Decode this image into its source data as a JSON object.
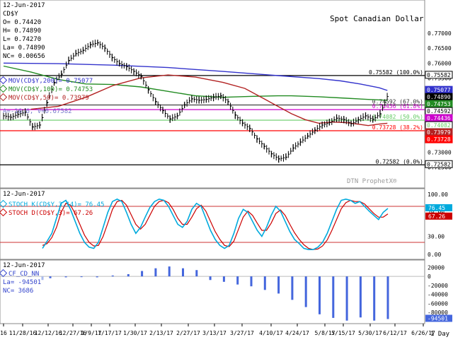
{
  "chart_data": [
    {
      "type": "ohlc",
      "panel": "price",
      "title": "Spot Canadian Dollar",
      "date": "12-Jun-2017",
      "symbol": "CD$Y",
      "ohlc_readout": [
        {
          "label": "O",
          "value": "0.74420"
        },
        {
          "label": "H",
          "value": "0.74890"
        },
        {
          "label": "L",
          "value": "0.74270"
        },
        {
          "label": "La",
          "value": "0.74890"
        },
        {
          "label": "NC",
          "value": "0.00656"
        }
      ],
      "legend": [
        {
          "text": "MOV(CD$Y,200)= 0.75077",
          "color": "#3333cc"
        },
        {
          "text": "MOV(CD$Y,100)= 0.74753",
          "color": "#228b22"
        },
        {
          "text": "MOV(CD$Y,50)= 0.73979",
          "color": "#b22222"
        }
      ],
      "extra_readout": "A=-16.6, V=0.67582",
      "ylim": [
        0.719,
        0.78
      ],
      "y_ticks": [
        "0.77000",
        "0.76500",
        "0.76000",
        "0.75500",
        "0.75000",
        "0.74500",
        "0.74000",
        "0.73500",
        "0.73000",
        "0.72500"
      ],
      "tick_values": [
        0.77,
        0.765,
        0.76,
        0.755,
        0.75,
        0.745,
        0.74,
        0.735,
        0.73,
        0.725
      ],
      "fib_levels": [
        {
          "value": 0.75582,
          "label": "0.75582 (100.0%)",
          "color": "#000000"
        },
        {
          "value": 0.74592,
          "label": "0.74592 (67.0%)",
          "color": "#333333"
        },
        {
          "value": 0.74436,
          "label": "0.74436 (61.8%)",
          "color": "#cc00cc"
        },
        {
          "value": 0.74082,
          "label": "0.74082 (50.0%)",
          "color": "#66cc66"
        },
        {
          "value": 0.73728,
          "label": "0.73728 (38.2%)",
          "color": "#ff0000"
        },
        {
          "value": 0.72582,
          "label": "0.72582 (0.0%)",
          "color": "#000000"
        }
      ],
      "right_badges": [
        {
          "value": 0.75582,
          "text": "0.75582",
          "bg": "#ffffff",
          "fg": "#000000"
        },
        {
          "value": 0.75077,
          "text": "0.75077",
          "bg": "#3333cc",
          "fg": "#ffffff"
        },
        {
          "value": 0.7489,
          "text": "0.74890",
          "bg": "#000000",
          "fg": "#ffffff"
        },
        {
          "value": 0.74753,
          "text": "0.74753",
          "bg": "#228b22",
          "fg": "#ffffff"
        },
        {
          "value": 0.74592,
          "text": "0.74592",
          "bg": "#ffffff",
          "fg": "#000000"
        },
        {
          "value": 0.74436,
          "text": "0.74436",
          "bg": "#cc00cc",
          "fg": "#ffffff"
        },
        {
          "value": 0.74082,
          "text": "0.74082",
          "bg": "#ffffff",
          "fg": "#66cc66"
        },
        {
          "value": 0.73979,
          "text": "0.73979",
          "bg": "#b22222",
          "fg": "#ffffff"
        },
        {
          "value": 0.73728,
          "text": "0.73728",
          "bg": "#ff0000",
          "fg": "#ffffff"
        },
        {
          "value": 0.72582,
          "text": "0.72582",
          "bg": "#ffffff",
          "fg": "#000000"
        }
      ],
      "series": [
        {
          "name": "MOV(CD$Y,200)",
          "color": "#3333cc",
          "points": [
            [
              0,
              0.76
            ],
            [
              20,
              0.7598
            ],
            [
              40,
              0.7593
            ],
            [
              60,
              0.7585
            ],
            [
              80,
              0.7572
            ],
            [
              100,
              0.7558
            ],
            [
              115,
              0.7548
            ],
            [
              123,
              0.754
            ],
            [
              130,
              0.753
            ],
            [
              137,
              0.7517
            ],
            [
              140,
              0.7508
            ]
          ]
        },
        {
          "name": "MOV(CD$Y,100)",
          "color": "#228b22",
          "points": [
            [
              0,
              0.759
            ],
            [
              10,
              0.757
            ],
            [
              20,
              0.7545
            ],
            [
              30,
              0.753
            ],
            [
              40,
              0.7528
            ],
            [
              50,
              0.752
            ],
            [
              60,
              0.7505
            ],
            [
              70,
              0.749
            ],
            [
              80,
              0.7485
            ],
            [
              90,
              0.7488
            ],
            [
              100,
              0.749
            ],
            [
              105,
              0.749
            ],
            [
              115,
              0.7487
            ],
            [
              125,
              0.7482
            ],
            [
              133,
              0.7478
            ],
            [
              140,
              0.7475
            ]
          ]
        },
        {
          "name": "MOV(CD$Y,50)",
          "color": "#b22222",
          "points": [
            [
              10,
              0.7445
            ],
            [
              20,
              0.7455
            ],
            [
              30,
              0.7485
            ],
            [
              40,
              0.7525
            ],
            [
              50,
              0.755
            ],
            [
              60,
              0.756
            ],
            [
              70,
              0.7553
            ],
            [
              80,
              0.7535
            ],
            [
              88,
              0.7515
            ],
            [
              95,
              0.748
            ],
            [
              100,
              0.7455
            ],
            [
              105,
              0.743
            ],
            [
              110,
              0.741
            ],
            [
              115,
              0.7398
            ],
            [
              120,
              0.7402
            ],
            [
              125,
              0.74
            ],
            [
              130,
              0.7394
            ],
            [
              133,
              0.739
            ],
            [
              137,
              0.7395
            ],
            [
              140,
              0.7398
            ]
          ]
        },
        {
          "name": "closes",
          "points": [
            [
              0,
              0.7423
            ],
            [
              4,
              0.7418
            ],
            [
              8,
              0.7428
            ],
            [
              12,
              0.7435
            ],
            [
              16,
              0.7385
            ],
            [
              20,
              0.7392
            ],
            [
              24,
              0.7468
            ],
            [
              28,
              0.7535
            ],
            [
              32,
              0.7563
            ],
            [
              36,
              0.7609
            ],
            [
              40,
              0.7632
            ],
            [
              44,
              0.7643
            ],
            [
              48,
              0.7662
            ],
            [
              52,
              0.7668
            ],
            [
              56,
              0.765
            ],
            [
              60,
              0.7618
            ],
            [
              64,
              0.7598
            ],
            [
              68,
              0.7588
            ],
            [
              72,
              0.7572
            ],
            [
              76,
              0.7555
            ],
            [
              80,
              0.751
            ],
            [
              84,
              0.747
            ],
            [
              88,
              0.744
            ],
            [
              92,
              0.7412
            ],
            [
              96,
              0.7423
            ],
            [
              100,
              0.746
            ],
            [
              104,
              0.748
            ],
            [
              108,
              0.7475
            ],
            [
              112,
              0.7478
            ],
            [
              116,
              0.7485
            ],
            [
              120,
              0.749
            ],
            [
              124,
              0.747
            ],
            [
              128,
              0.7425
            ],
            [
              132,
              0.7398
            ],
            [
              136,
              0.738
            ],
            [
              140,
              0.7345
            ],
            [
              144,
              0.732
            ],
            [
              148,
              0.7295
            ],
            [
              152,
              0.7278
            ],
            [
              156,
              0.7284
            ],
            [
              160,
              0.7315
            ],
            [
              164,
              0.7335
            ],
            [
              168,
              0.7355
            ],
            [
              172,
              0.7375
            ],
            [
              176,
              0.7392
            ],
            [
              180,
              0.74
            ],
            [
              184,
              0.7415
            ],
            [
              188,
              0.741
            ],
            [
              192,
              0.7396
            ],
            [
              196,
              0.741
            ],
            [
              200,
              0.7423
            ],
            [
              204,
              0.741
            ],
            [
              208,
              0.743
            ],
            [
              212,
              0.7489
            ]
          ]
        }
      ],
      "watermark": "DTN ProphetX®"
    },
    {
      "type": "line",
      "panel": "stochastic",
      "date": "12-Jun-2017",
      "legend": [
        {
          "text": "STOCH K(CD$Y,3,14)= 76.45",
          "color": "#00aadd"
        },
        {
          "text": "STOCH D(CD$Y,3)= 67.26",
          "color": "#cc0000"
        }
      ],
      "ylim": [
        0,
        100
      ],
      "y_ticks": [
        "100.00",
        "70.00",
        "30.00",
        "0.00"
      ],
      "tick_values": [
        100,
        70,
        30,
        0
      ],
      "levels": [
        80,
        20
      ],
      "right_badges": [
        {
          "value": 76.45,
          "text": "76.45",
          "bg": "#00aadd",
          "fg": "#ffffff"
        },
        {
          "value": 67.26,
          "text": "67.26",
          "bg": "#cc0000",
          "fg": "#ffffff"
        }
      ],
      "k_values": [
        10,
        22,
        35,
        60,
        85,
        90,
        75,
        55,
        35,
        20,
        12,
        10,
        20,
        45,
        70,
        88,
        92,
        88,
        70,
        50,
        35,
        45,
        62,
        78,
        88,
        92,
        90,
        80,
        65,
        50,
        45,
        55,
        75,
        85,
        80,
        60,
        40,
        25,
        15,
        10,
        15,
        35,
        60,
        75,
        70,
        55,
        40,
        30,
        45,
        65,
        80,
        72,
        55,
        38,
        25,
        18,
        10,
        8,
        8,
        12,
        20,
        35,
        55,
        75,
        90,
        92,
        90,
        85,
        88,
        80,
        72,
        65,
        58,
        70,
        76.45
      ],
      "d_values": [
        15,
        18,
        28,
        45,
        70,
        85,
        82,
        68,
        50,
        32,
        20,
        14,
        15,
        30,
        52,
        75,
        88,
        90,
        82,
        66,
        50,
        42,
        50,
        65,
        80,
        88,
        90,
        86,
        75,
        60,
        50,
        50,
        62,
        76,
        82,
        72,
        55,
        38,
        25,
        15,
        13,
        22,
        42,
        62,
        72,
        65,
        52,
        40,
        40,
        52,
        68,
        74,
        65,
        50,
        36,
        25,
        16,
        10,
        8,
        9,
        14,
        24,
        40,
        58,
        76,
        86,
        90,
        88,
        88,
        84,
        76,
        68,
        62,
        62,
        67.26
      ]
    },
    {
      "type": "bar",
      "panel": "cot",
      "date": "12-Jun-2017",
      "legend_title": "CF_CD_NN",
      "readout": [
        {
          "label": "La",
          "value": "-94501"
        },
        {
          "label": "NC",
          "value": "3686"
        }
      ],
      "ylim": [
        -100000,
        30000
      ],
      "y_ticks": [
        "20000",
        "0",
        "-20000",
        "-40000",
        "-60000",
        "-80000"
      ],
      "tick_values": [
        20000,
        0,
        -20000,
        -40000,
        -60000,
        -80000
      ],
      "right_badges": [
        {
          "value": -94501,
          "text": "-94501",
          "bg": "#4466dd",
          "fg": "#ffffff"
        }
      ],
      "bars": [
        [
          32,
          -8000
        ],
        [
          40,
          -4000
        ],
        [
          56,
          -2000
        ],
        [
          72,
          -1500
        ],
        [
          88,
          -2000
        ],
        [
          104,
          2000
        ],
        [
          120,
          5000
        ],
        [
          134,
          12000
        ],
        [
          148,
          18000
        ],
        [
          162,
          22000
        ],
        [
          176,
          18000
        ],
        [
          190,
          14000
        ],
        [
          204,
          -8000
        ],
        [
          218,
          -12000
        ],
        [
          232,
          -18000
        ],
        [
          246,
          -22000
        ],
        [
          260,
          -30000
        ],
        [
          274,
          -38000
        ],
        [
          288,
          -52000
        ],
        [
          302,
          -68000
        ],
        [
          316,
          -84000
        ],
        [
          330,
          -92000
        ],
        [
          344,
          -98000
        ],
        [
          358,
          -91000
        ],
        [
          372,
          -98000
        ],
        [
          386,
          -94501
        ]
      ],
      "bar_color": "#4466dd",
      "first_bar_color": "#aabbee"
    }
  ],
  "x_axis": {
    "labels": [
      "16",
      "11/28/16",
      "12/12/16",
      "12/27/16",
      "1/9/17",
      "1/17/17",
      "1/30/17",
      "2/13/17",
      "2/27/17",
      "3/13/17",
      "3/27/17",
      "4/10/17",
      "4/24/17",
      "5/8/17",
      "5/15/17",
      "5/30/17",
      "6/12/17",
      "6/26/17"
    ],
    "positions": [
      5,
      32,
      68,
      103,
      129,
      155,
      191,
      228,
      266,
      303,
      342,
      383,
      420,
      459,
      485,
      523,
      558,
      598
    ],
    "period_label": "1 Day"
  }
}
